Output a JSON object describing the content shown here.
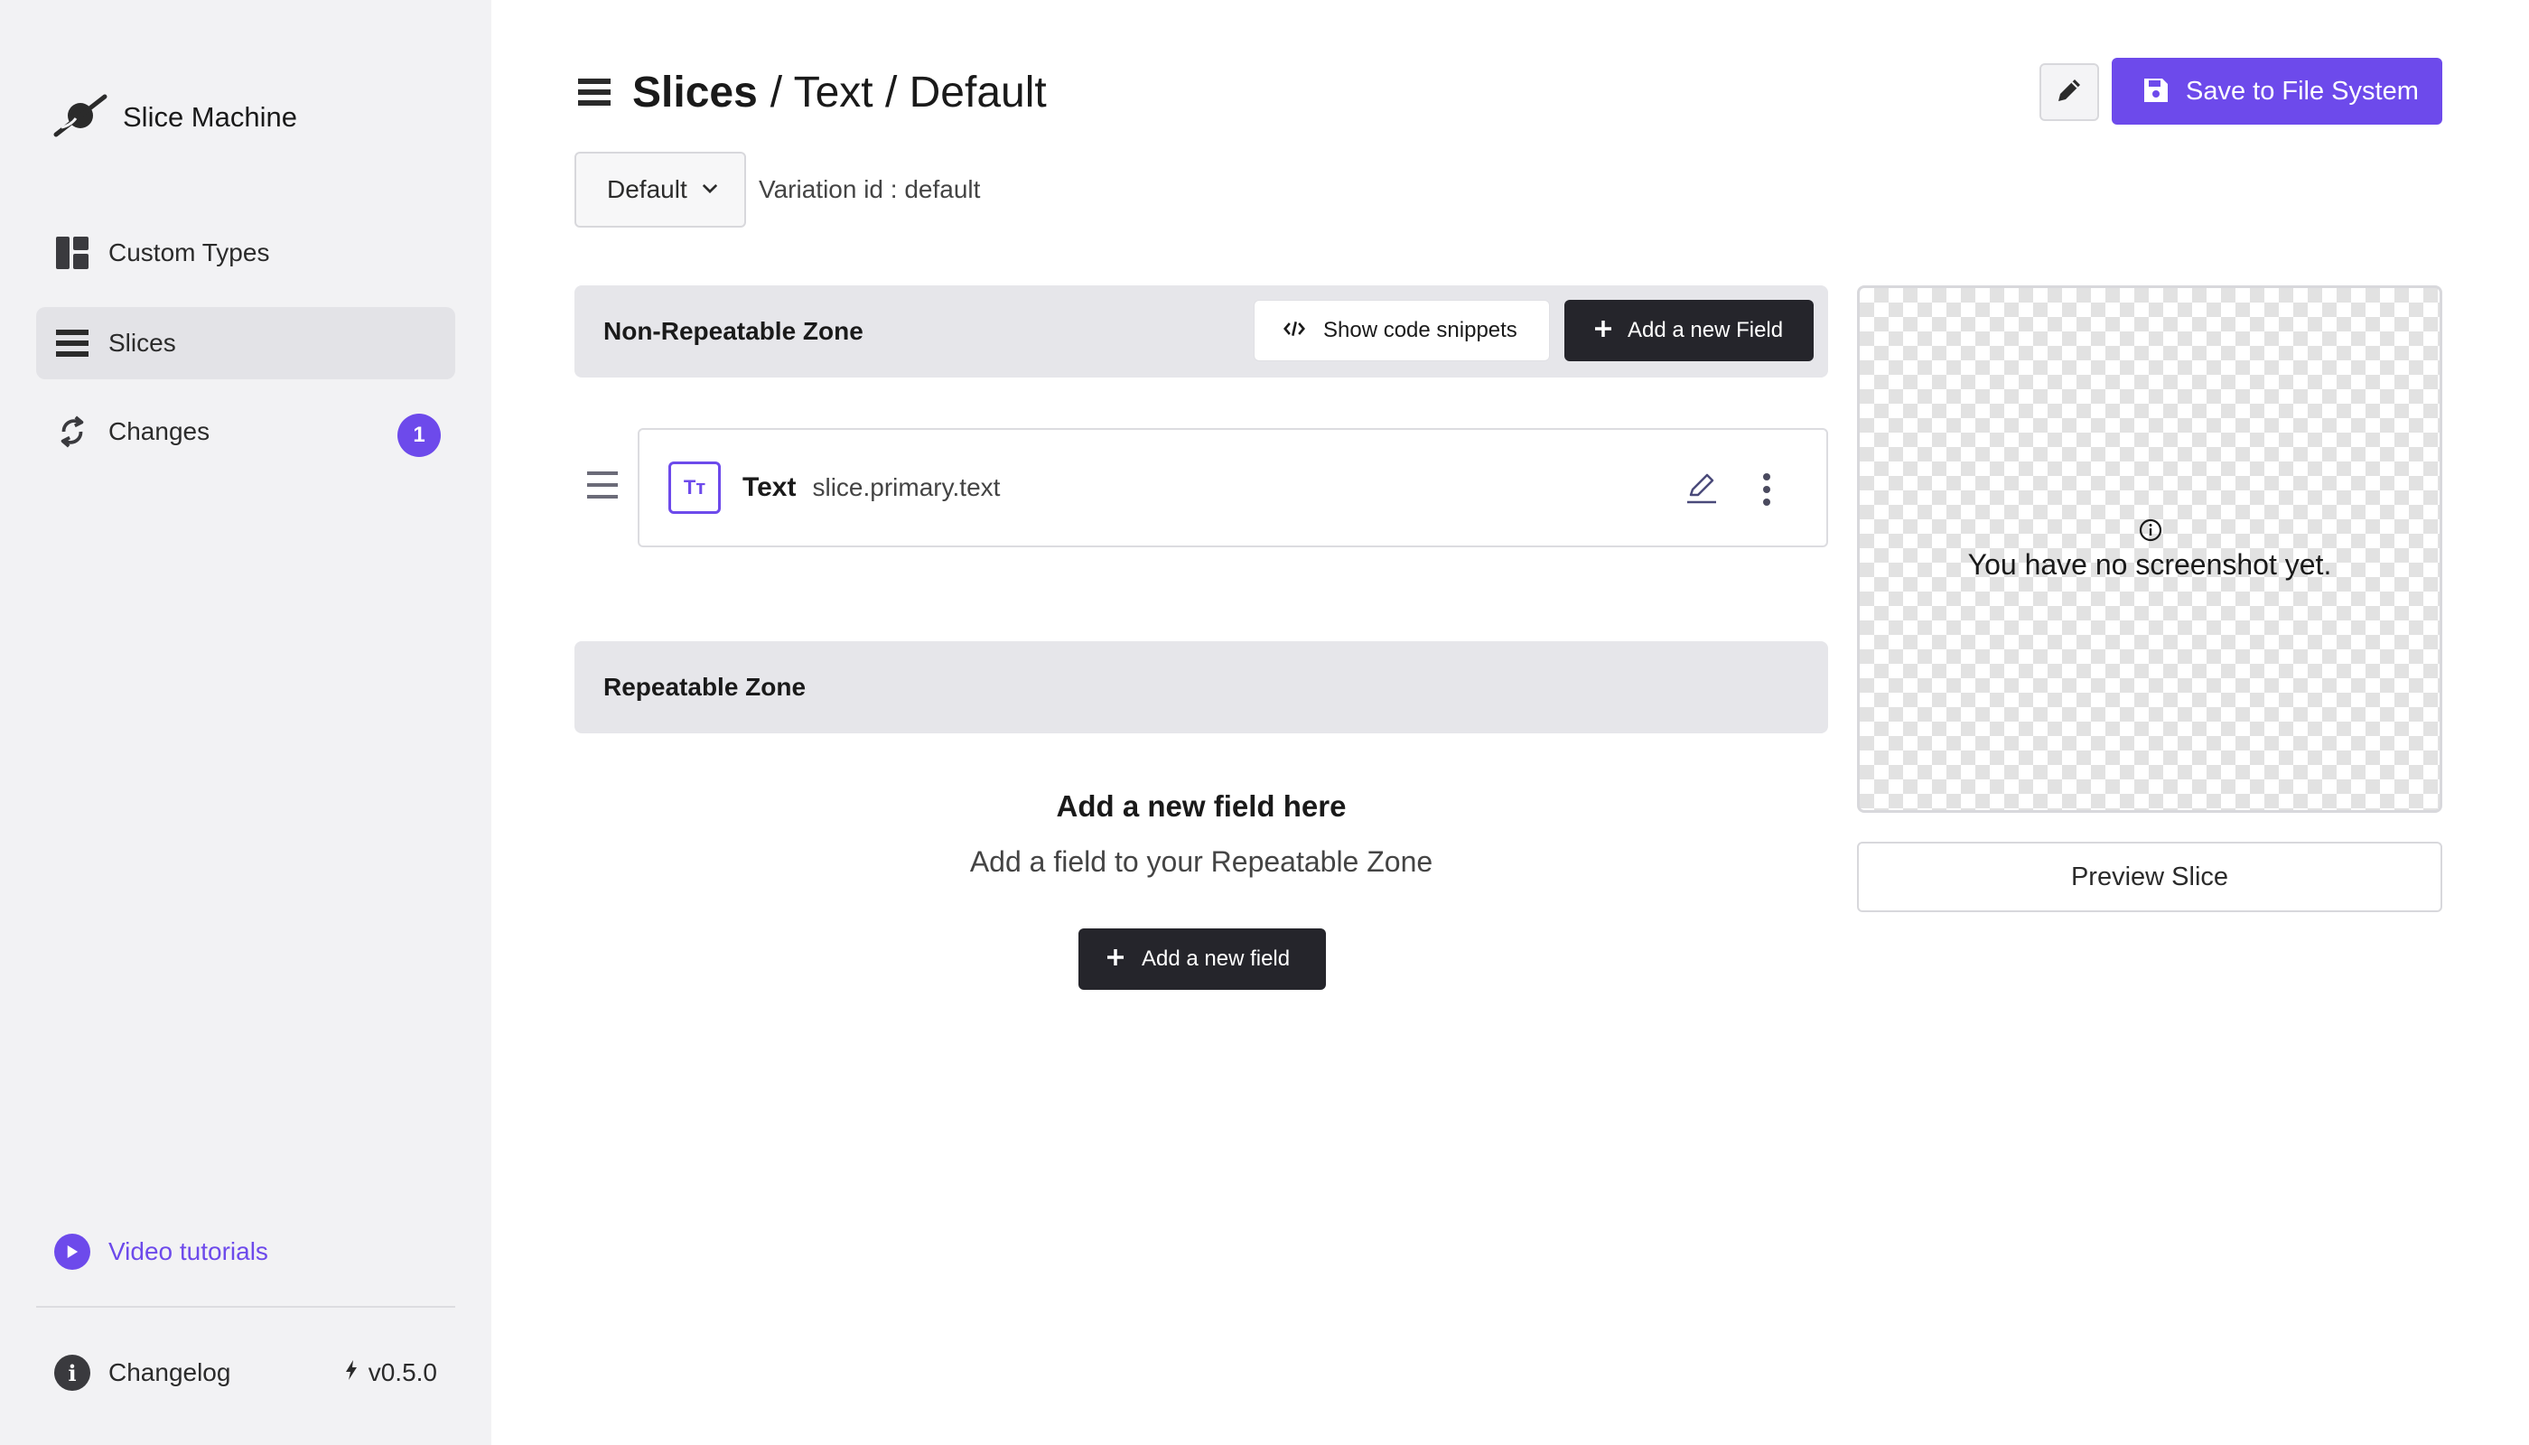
{
  "brand": {
    "name": "Slice Machine",
    "icon": "slice-machine-logo-icon"
  },
  "sidebar": {
    "items": [
      {
        "label": "Custom Types",
        "icon": "layout-icon",
        "active": false
      },
      {
        "label": "Slices",
        "icon": "hamburger-icon",
        "active": true
      },
      {
        "label": "Changes",
        "icon": "sync-icon",
        "active": false,
        "badge": "1"
      }
    ],
    "video_tutorials": "Video tutorials",
    "changelog": "Changelog",
    "version": "v0.5.0"
  },
  "header": {
    "crumb_main": "Slices",
    "crumb_rest": "/ Text / Default",
    "save_label": "Save to File System"
  },
  "variation": {
    "selected": "Default",
    "id_text": "Variation id : default"
  },
  "non_repeatable": {
    "title": "Non-Repeatable Zone",
    "snippets_label": "Show code snippets",
    "add_label": "Add a new Field",
    "fields": [
      {
        "type_icon": "Tт",
        "name": "Text",
        "key": "slice.primary.text"
      }
    ]
  },
  "repeatable": {
    "title": "Repeatable Zone",
    "empty_title": "Add a new field here",
    "empty_subtitle": "Add a field to your Repeatable Zone",
    "add_label": "Add a new field"
  },
  "screenshot": {
    "empty_text": "You have no screenshot yet.",
    "preview_label": "Preview Slice"
  },
  "colors": {
    "accent": "#6d4aeb",
    "dark_button": "#25252b",
    "sidebar_bg": "#f2f2f4"
  }
}
